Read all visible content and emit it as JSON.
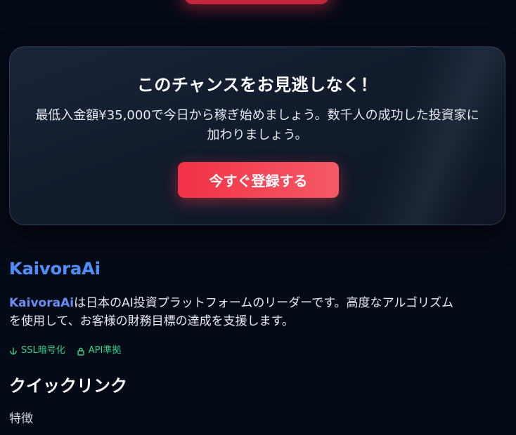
{
  "cta": {
    "title": "このチャンスをお見逃しなく！",
    "text": "最低入金額¥35,000で今日から稼ぎ始めましょう。数千人の成功した投資家に加わりましょう。",
    "button_label": "今すぐ登録する"
  },
  "brand": {
    "name": "KaivoraAi",
    "inline_name": "KaivoraAi",
    "description": "は日本のAI投資プラットフォームのリーダーです。高度なアルゴリズムを使用して、お客様の財務目標の達成を支援します。"
  },
  "badges": [
    {
      "icon": "shield-icon",
      "label": "SSL暗号化"
    },
    {
      "icon": "lock-icon",
      "label": "API準拠"
    }
  ],
  "quick_links": {
    "heading": "クイックリンク",
    "items": [
      "特徴"
    ]
  },
  "colors": {
    "background": "#050a17",
    "accent_red": "#f23245",
    "brand_blue": "#4f8ef7",
    "badge_green": "#36d08a"
  }
}
